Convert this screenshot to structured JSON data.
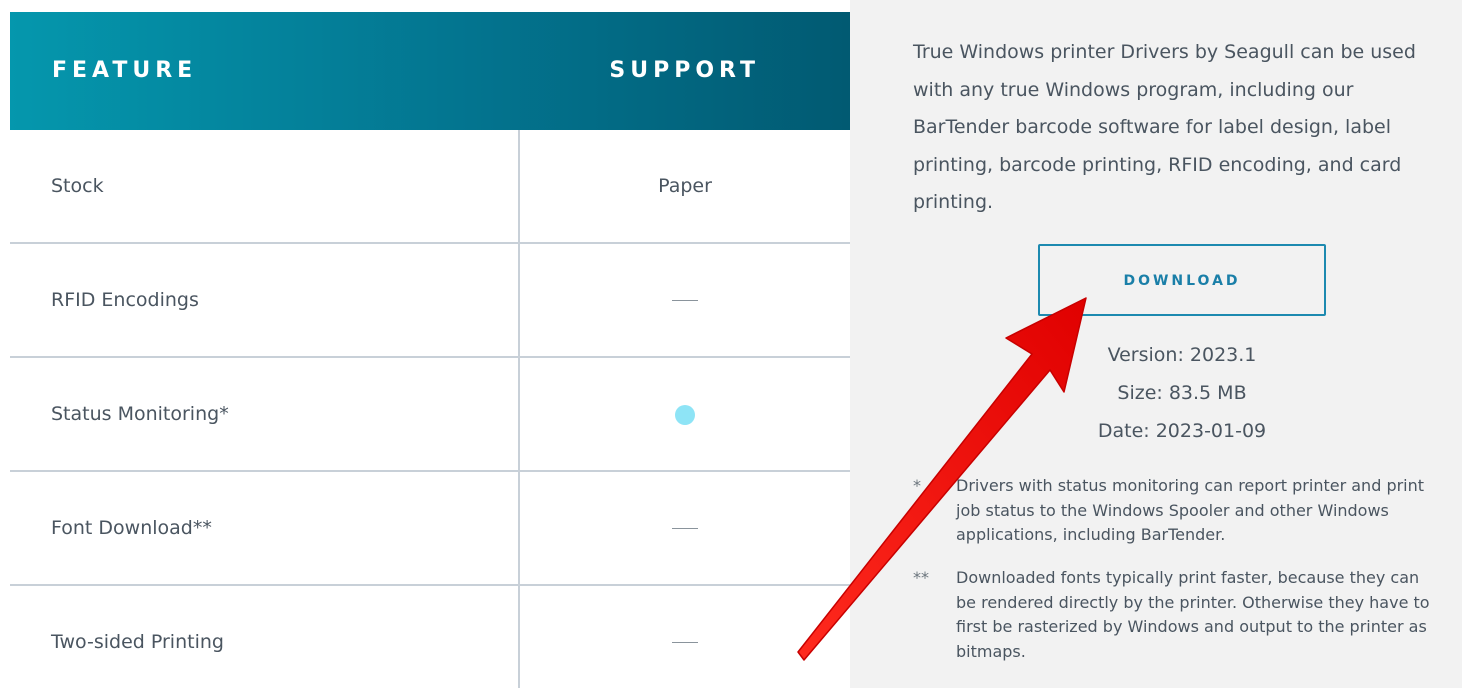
{
  "table": {
    "header": {
      "feature": "FEATURE",
      "support": "SUPPORT"
    },
    "rows": [
      {
        "feature": "Stock",
        "support": "Paper"
      },
      {
        "feature": "RFID Encodings",
        "support": "—",
        "support_kind": "dash"
      },
      {
        "feature": "Status Monitoring*",
        "support": "",
        "support_kind": "dot"
      },
      {
        "feature": "Font Download**",
        "support": "—",
        "support_kind": "dash"
      },
      {
        "feature": "Two-sided Printing",
        "support": "—",
        "support_kind": "dash"
      }
    ]
  },
  "side_panel": {
    "intro": "True Windows printer Drivers by Seagull can be used with any true Windows program, including our BarTender barcode software for label design, label printing, barcode printing, RFID encoding, and card printing.",
    "download_label": "DOWNLOAD",
    "version": "Version: 2023.1",
    "size": "Size: 83.5 MB",
    "date": "Date: 2023-01-09",
    "footnotes": [
      {
        "mark": "*",
        "text": "Drivers with status monitoring can report printer and print job status to the Windows Spooler and other Windows applications, including BarTender."
      },
      {
        "mark": "**",
        "text": "Downloaded fonts typically print faster, because they can be rendered directly by the printer. Otherwise they have to first be rasterized by Windows and output to the printer as bitmaps."
      }
    ]
  },
  "colors": {
    "header_gradient_start": "#0597ad",
    "header_gradient_end": "#015a72",
    "accent": "#1d8ab0",
    "status_dot": "#8ee4f6",
    "annotation_arrow": "#ff0000"
  },
  "icons": {
    "status_dot": "supported-dot-icon",
    "dash": "not-supported-dash-icon",
    "annotation": "red-arrow-annotation"
  }
}
